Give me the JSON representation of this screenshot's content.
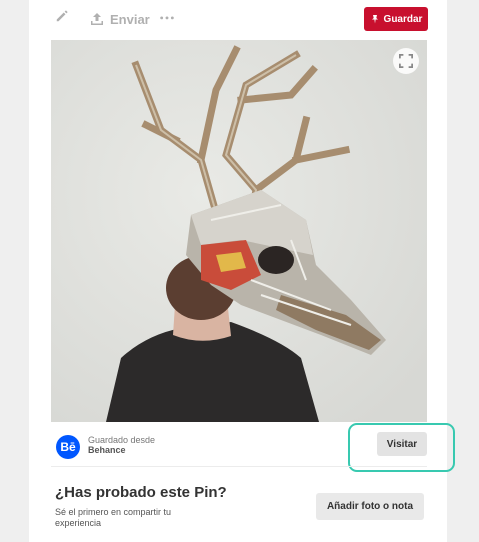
{
  "toolbar": {
    "edit_icon": "pencil-icon",
    "share_icon": "share-icon",
    "share_label": "Enviar",
    "more_icon": "more-icon",
    "save_label": "Guardar"
  },
  "pin": {
    "image_description_icon": "photo-cardboard-deer-mask",
    "zoom_icon": "expand-icon"
  },
  "source": {
    "badge": "Bē",
    "saved_from_label": "Guardado desde",
    "source_name": "Behance",
    "visit_label": "Visitar"
  },
  "tried": {
    "title": "¿Has probado este Pin?",
    "subtitle": "Sé el primero en compartir tu experiencia",
    "add_button_label": "Añadir foto o nota"
  },
  "colors": {
    "brand_red": "#c8102e",
    "behance_blue": "#0057ff",
    "highlight": "#38c9b0"
  }
}
